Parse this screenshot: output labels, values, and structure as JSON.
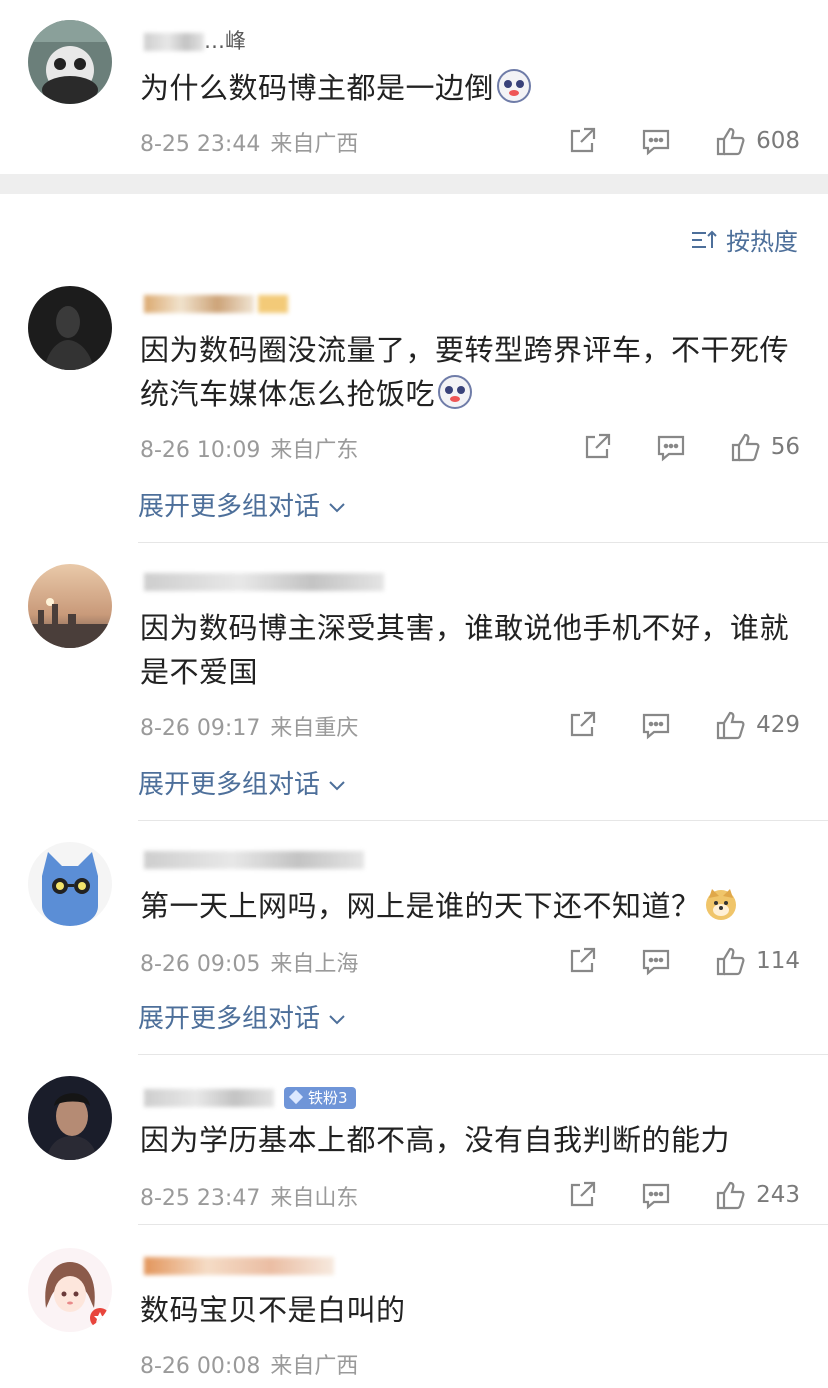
{
  "top_comment": {
    "username_visible": "…峰",
    "text": "为什么数码博主都是一边倒",
    "time": "8-25 23:44",
    "location": "来自广西",
    "likes": "608"
  },
  "sort": {
    "label": "按热度"
  },
  "comments": [
    {
      "username_visible": "",
      "text": "因为数码圈没流量了，要转型跨界评车，不干死传统汽车媒体怎么抢饭吃",
      "time": "8-26 10:09",
      "location": "来自广东",
      "likes": "56",
      "expand": "展开更多组对话"
    },
    {
      "username_visible": "",
      "text": "因为数码博主深受其害，谁敢说他手机不好，谁就是不爱国",
      "time": "8-26 09:17",
      "location": "来自重庆",
      "likes": "429",
      "expand": "展开更多组对话"
    },
    {
      "username_visible": "",
      "text": "第一天上网吗，网上是谁的天下还不知道？",
      "time": "8-26 09:05",
      "location": "来自上海",
      "likes": "114",
      "expand": "展开更多组对话"
    },
    {
      "username_visible": "",
      "badge": "铁粉3",
      "text": "因为学历基本上都不高，没有自我判断的能力",
      "time": "8-25 23:47",
      "location": "来自山东",
      "likes": "243"
    },
    {
      "username_visible": "",
      "text": "数码宝贝不是白叫的",
      "time": "8-26 00:08",
      "location": "来自广西"
    }
  ],
  "icons": {
    "share": "share-icon",
    "comment": "comment-icon",
    "like": "thumbs-up-icon",
    "sort": "sort-icon"
  },
  "colors": {
    "link": "#4d6f9a",
    "meta": "#9a9a9a",
    "badge": "#6f95d8"
  }
}
